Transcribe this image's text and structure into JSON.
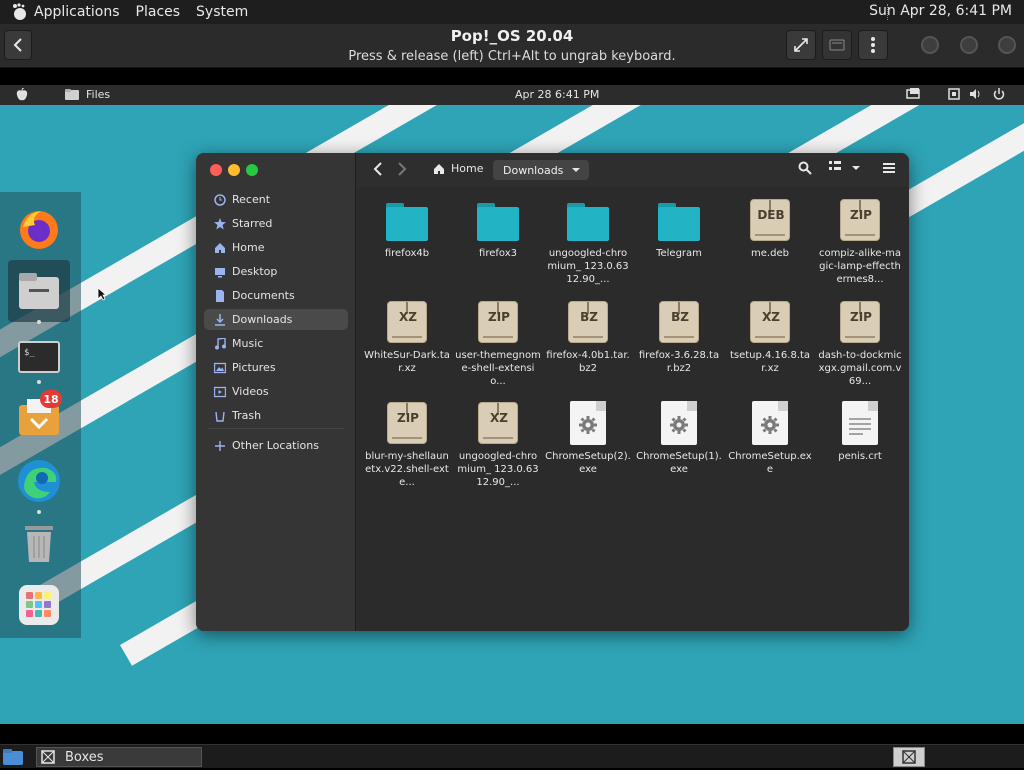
{
  "host_panel": {
    "menu": [
      "Applications",
      "Places",
      "System"
    ],
    "clock": "Sun Apr 28,  6:41 PM"
  },
  "boxes": {
    "title": "Pop!_OS 20.04",
    "subtitle": "Press & release (left) Ctrl+Alt to ungrab keyboard."
  },
  "guest_panel": {
    "app_name": "Files",
    "clock": "Apr 28    6:41 PM"
  },
  "dock": {
    "badge_count": "18",
    "items": [
      "firefox-icon",
      "files-icon",
      "terminal-icon",
      "installer-icon",
      "edge-icon",
      "trash-icon",
      "app-grid-icon"
    ]
  },
  "sidebar": {
    "items": [
      {
        "label": "Recent",
        "icon": "clock-icon"
      },
      {
        "label": "Starred",
        "icon": "star-icon"
      },
      {
        "label": "Home",
        "icon": "home-icon"
      },
      {
        "label": "Desktop",
        "icon": "desktop-icon"
      },
      {
        "label": "Documents",
        "icon": "document-icon"
      },
      {
        "label": "Downloads",
        "icon": "download-icon",
        "active": true
      },
      {
        "label": "Music",
        "icon": "music-icon"
      },
      {
        "label": "Pictures",
        "icon": "picture-icon"
      },
      {
        "label": "Videos",
        "icon": "video-icon"
      },
      {
        "label": "Trash",
        "icon": "trash-icon"
      }
    ],
    "other": "Other Locations"
  },
  "breadcrumb": {
    "home": "Home",
    "current": "Downloads"
  },
  "files": [
    {
      "name": "firefox4b",
      "type": "folder"
    },
    {
      "name": "firefox3",
      "type": "folder"
    },
    {
      "name": "ungoogled-chromium_ 123.0.6312.90_...",
      "type": "folder"
    },
    {
      "name": "Telegram",
      "type": "folder"
    },
    {
      "name": "me.deb",
      "type": "archive",
      "tag": "DEB"
    },
    {
      "name": "compiz-alike-magic-lamp-effecthermes8...",
      "type": "archive",
      "tag": "ZIP"
    },
    {
      "name": "WhiteSur-Dark.tar.xz",
      "type": "archive",
      "tag": "XZ"
    },
    {
      "name": "user-themegnome-shell-extensio...",
      "type": "archive",
      "tag": "ZIP"
    },
    {
      "name": "firefox-4.0b1.tar.bz2",
      "type": "archive",
      "tag": "BZ"
    },
    {
      "name": "firefox-3.6.28.tar.bz2",
      "type": "archive",
      "tag": "BZ"
    },
    {
      "name": "tsetup.4.16.8.tar.xz",
      "type": "archive",
      "tag": "XZ"
    },
    {
      "name": "dash-to-dockmicxgx.gmail.com.v69...",
      "type": "archive",
      "tag": "ZIP"
    },
    {
      "name": "blur-my-shellaunetx.v22.shell-exte...",
      "type": "archive",
      "tag": "ZIP"
    },
    {
      "name": "ungoogled-chromium_ 123.0.6312.90_...",
      "type": "archive",
      "tag": "XZ"
    },
    {
      "name": "ChromeSetup(2).exe",
      "type": "exe"
    },
    {
      "name": "ChromeSetup(1).exe",
      "type": "exe"
    },
    {
      "name": "ChromeSetup.exe",
      "type": "exe"
    },
    {
      "name": "penis.crt",
      "type": "text"
    }
  ],
  "taskbar": {
    "task_label": "Boxes"
  },
  "colors": {
    "desktop": "#2ea4b6",
    "folder": "#22b3c4",
    "badge": "#e53935"
  }
}
